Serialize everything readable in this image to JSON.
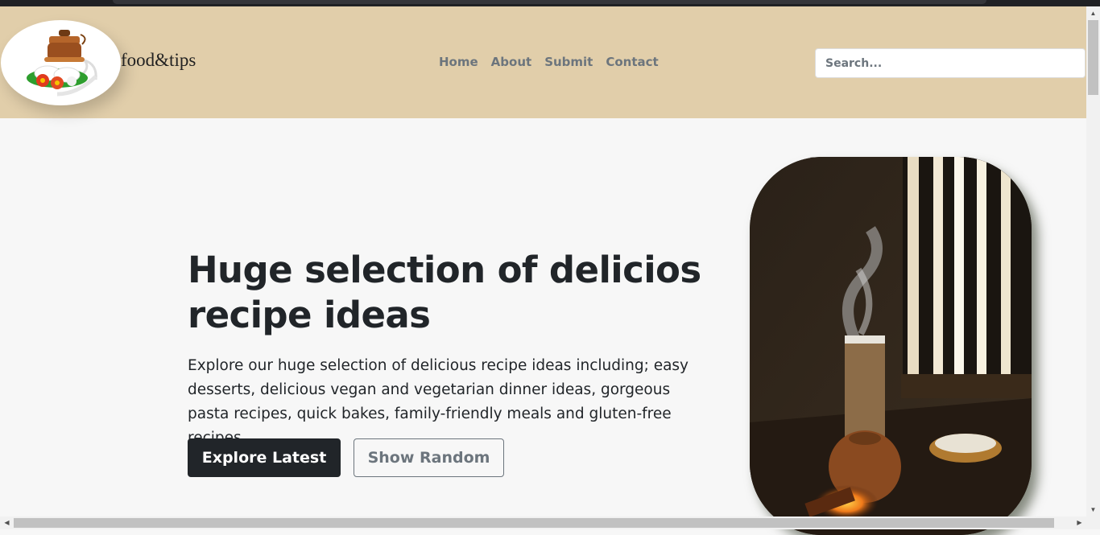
{
  "brand": {
    "name": "food&tips"
  },
  "nav": {
    "items": [
      {
        "label": "Home"
      },
      {
        "label": "About"
      },
      {
        "label": "Submit"
      },
      {
        "label": "Contact"
      }
    ]
  },
  "search": {
    "placeholder": "Search..."
  },
  "hero": {
    "title": "Huge selection of delicios recipe ideas",
    "description": "Explore our huge selection of delicious recipe ideas including; easy desserts, delicious vegan and vegetarian dinner ideas, gorgeous pasta recipes, quick bakes, family-friendly meals and gluten-free recipes.",
    "primary_button": "Explore Latest",
    "secondary_button": "Show Random"
  },
  "colors": {
    "header_bg": "#e1ceaa",
    "page_bg": "#f7f7f7",
    "primary_btn": "#212529",
    "muted": "#6c757d"
  }
}
